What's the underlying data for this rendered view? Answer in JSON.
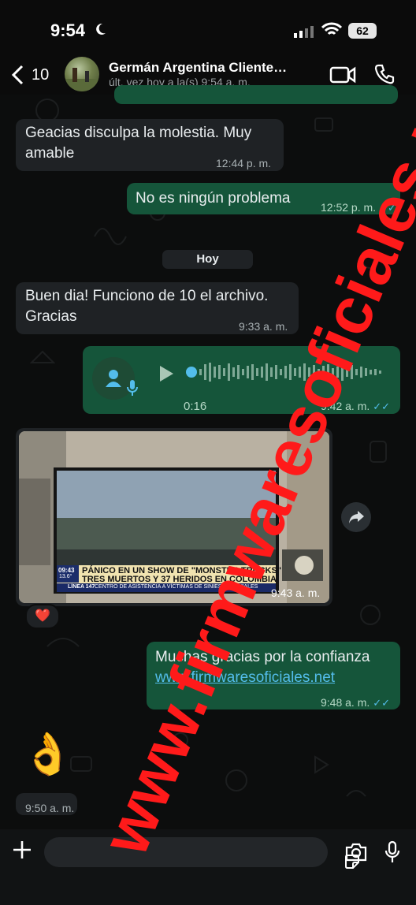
{
  "status_bar": {
    "time": "9:54",
    "battery": "62"
  },
  "header": {
    "back_count": "10",
    "contact_name": "Germán Argentina Cliente…",
    "contact_status": "últ. vez hoy a la(s) 9:54 a. m."
  },
  "messages": {
    "m1": {
      "text": "Geacias disculpa la molestia.  Muy amable",
      "time": "12:44 p. m."
    },
    "m2": {
      "text": "No es ningún problema",
      "time": "12:52 p. m."
    },
    "day_separator": "Hoy",
    "m3": {
      "text": "Buen dia! Funciono de 10 el archivo. Gracias",
      "time": "9:33 a. m."
    },
    "voice": {
      "duration": "0:16",
      "time": "9:42 a. m."
    },
    "media": {
      "time": "9:43 a. m.",
      "tv_clock": "09:43",
      "tv_temp": "13.6°",
      "headline1": "PÁNICO EN UN SHOW DE \"MONSTER TRUCKS\"",
      "headline2": "TRES MUERTOS Y 37 HERIDOS EN COLOMBIA",
      "ticker_line": "LÍNEA 147",
      "ticker_text": "CENTRO DE ASISTENCIA A VÍCTIMAS DE SINIESTROS VIALES",
      "reaction": "❤️"
    },
    "m4": {
      "text": "Muchas gracias por la confianza",
      "link": "www.firmwaresoficiales.net",
      "time": "9:48 a. m."
    },
    "m5": {
      "emoji": "👌",
      "time": "9:50 a. m."
    }
  },
  "watermark": "www.firmwaresoficiales.net",
  "colors": {
    "incoming": "#1f2225",
    "outgoing": "#15553a",
    "read_ticks": "#53bdeb",
    "watermark": "#ff1a1a"
  },
  "icons": [
    "back-chevron-icon",
    "video-call-icon",
    "phone-icon",
    "moon-icon",
    "signal-icon",
    "wifi-icon",
    "play-icon",
    "mic-icon",
    "forward-icon",
    "plus-icon",
    "sticker-icon",
    "camera-icon"
  ]
}
